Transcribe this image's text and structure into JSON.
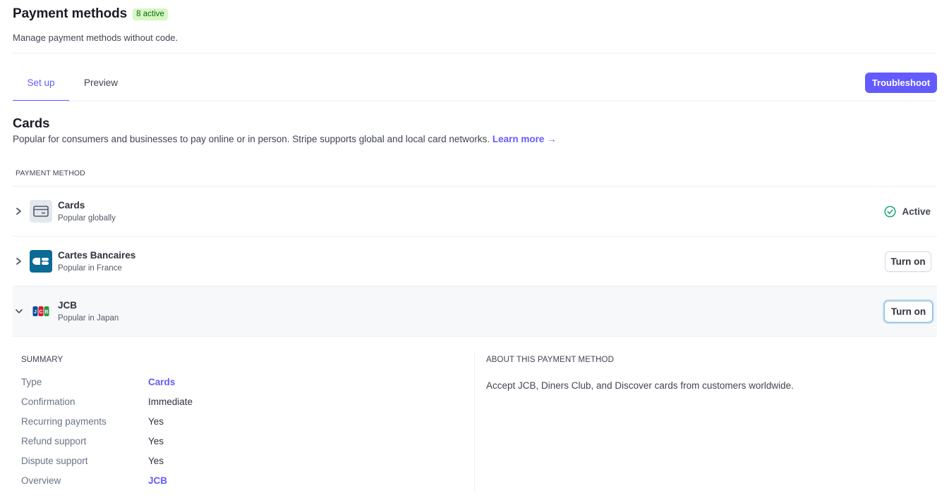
{
  "header": {
    "title": "Payment methods",
    "badge": "8 active",
    "subtitle": "Manage payment methods without code."
  },
  "tabs": [
    {
      "label": "Set up",
      "active": true
    },
    {
      "label": "Preview",
      "active": false
    }
  ],
  "troubleshoot_label": "Troubleshoot",
  "section": {
    "title": "Cards",
    "description": "Popular for consumers and businesses to pay online or in person. Stripe supports global and local card networks.",
    "learn_more": "Learn more →"
  },
  "table": {
    "column_header": "PAYMENT METHOD",
    "rows": [
      {
        "name": "Cards",
        "subtitle": "Popular globally",
        "status": "Active",
        "icon": "card-icon",
        "expanded": false
      },
      {
        "name": "Cartes Bancaires",
        "subtitle": "Popular in France",
        "action": "Turn on",
        "icon": "cb-logo-icon",
        "logo_text": "CB",
        "expanded": false
      },
      {
        "name": "JCB",
        "subtitle": "Popular in Japan",
        "action": "Turn on",
        "icon": "jcb-logo-icon",
        "logo_text": "JCB",
        "expanded": true
      }
    ]
  },
  "details": {
    "summary_title": "SUMMARY",
    "summary": [
      {
        "key": "Type",
        "value": "Cards",
        "link": true
      },
      {
        "key": "Confirmation",
        "value": "Immediate",
        "link": false
      },
      {
        "key": "Recurring payments",
        "value": "Yes",
        "link": false
      },
      {
        "key": "Refund support",
        "value": "Yes",
        "link": false
      },
      {
        "key": "Dispute support",
        "value": "Yes",
        "link": false
      },
      {
        "key": "Overview",
        "value": "JCB",
        "link": true
      }
    ],
    "about_title": "ABOUT THIS PAYMENT METHOD",
    "about_text": "Accept JCB, Diners Club, and Discover cards from customers worldwide."
  },
  "colors": {
    "accent": "#635bff",
    "success": "#1ea672",
    "badge_bg": "#d7f7c2",
    "cb_blue": "#0b6a96"
  }
}
